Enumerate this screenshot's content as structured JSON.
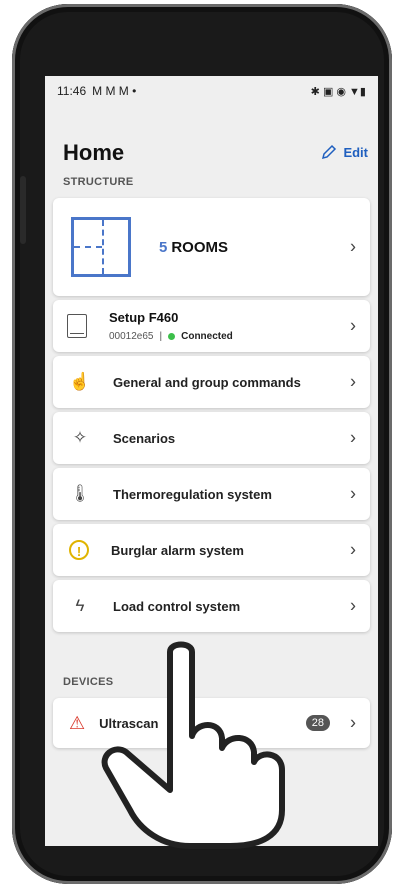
{
  "statusbar": {
    "time": "11:46",
    "notifications": "M M M •",
    "right_icons": "✱ ▣ ◉ ▼▮"
  },
  "header": {
    "title": "Home",
    "edit_label": "Edit"
  },
  "structure": {
    "section_label": "STRUCTURE",
    "rooms": {
      "count": "5",
      "label": "ROOMS"
    },
    "setup": {
      "name": "Setup F460",
      "id": "00012e65",
      "separator": "|",
      "status": "Connected"
    },
    "menu": [
      {
        "icon": "hand-icon",
        "label": "General and group commands"
      },
      {
        "icon": "wand-icon",
        "label": "Scenarios"
      },
      {
        "icon": "thermometer-icon",
        "label": "Thermoregulation system"
      },
      {
        "icon": "alarm-icon",
        "label": "Burglar alarm system"
      },
      {
        "icon": "lightning-icon",
        "label": "Load control system"
      }
    ]
  },
  "devices": {
    "section_label": "DEVICES",
    "first_device_label": "Ultrascan",
    "badge": "28"
  },
  "colors": {
    "accent": "#1f5fbf",
    "connected": "#3cbf4a",
    "warning": "#d9372a",
    "alarm": "#e0b400"
  }
}
